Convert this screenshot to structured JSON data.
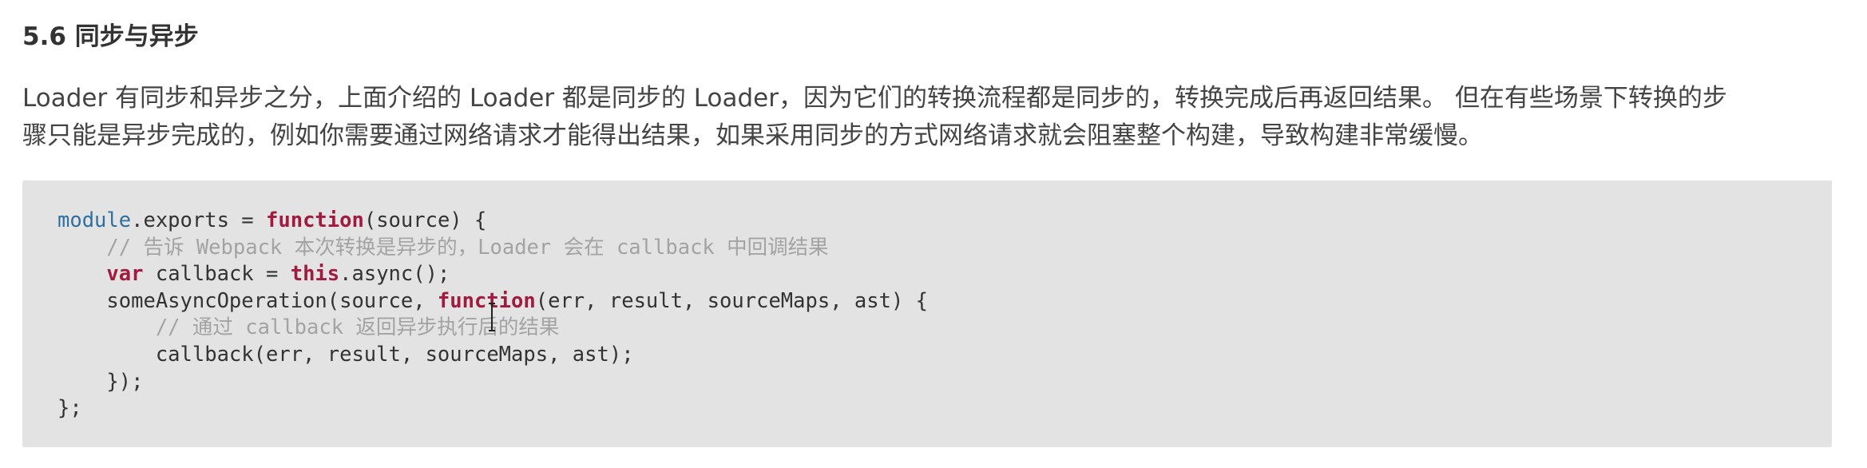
{
  "section": {
    "title": "5.6 同步与异步"
  },
  "paragraph": {
    "lines": [
      "Loader 有同步和异步之分，上面介绍的 Loader 都是同步的 Loader，因为它们的转换流程都是同步的，转换完成后再返回结果。 但在有些场景下转换的步",
      "骤只能是异步完成的，例如你需要通过网络请求才能得出结果，如果采用同步的方式网络请求就会阻塞整个构建，导致构建非常缓慢。"
    ]
  },
  "code": {
    "lines": [
      [
        {
          "t": "module",
          "k": "builtin"
        },
        {
          "t": ".exports = ",
          "k": "plain"
        },
        {
          "t": "function",
          "k": "keyword"
        },
        {
          "t": "(source) {",
          "k": "plain"
        }
      ],
      [
        {
          "t": "    // 告诉 Webpack 本次转换是异步的，Loader 会在 callback 中回调结果",
          "k": "comment"
        }
      ],
      [
        {
          "t": "    ",
          "k": "plain"
        },
        {
          "t": "var",
          "k": "keyword"
        },
        {
          "t": " callback = ",
          "k": "plain"
        },
        {
          "t": "this",
          "k": "keyword"
        },
        {
          "t": ".async();",
          "k": "plain"
        }
      ],
      [
        {
          "t": "    someAsyncOperation(source, ",
          "k": "plain"
        },
        {
          "t": "function",
          "k": "keyword"
        },
        {
          "t": "(err, result, sourceMaps, ast) {",
          "k": "plain"
        }
      ],
      [
        {
          "t": "        // 通过 callback 返回异步执行后的结果",
          "k": "comment"
        }
      ],
      [
        {
          "t": "        callback(err, result, sourceMaps, ast);",
          "k": "plain"
        }
      ],
      [
        {
          "t": "    });",
          "k": "plain"
        }
      ],
      [
        {
          "t": "};",
          "k": "plain"
        }
      ]
    ]
  },
  "cursor": {
    "icon": "i-beam-cursor-icon",
    "color": "#222222"
  },
  "colors": {
    "keyword": "#a11a3f",
    "builtin": "#2f6f9f",
    "comment": "#a3a3a3",
    "code_background": "#e3e3e3",
    "text": "#333333"
  }
}
